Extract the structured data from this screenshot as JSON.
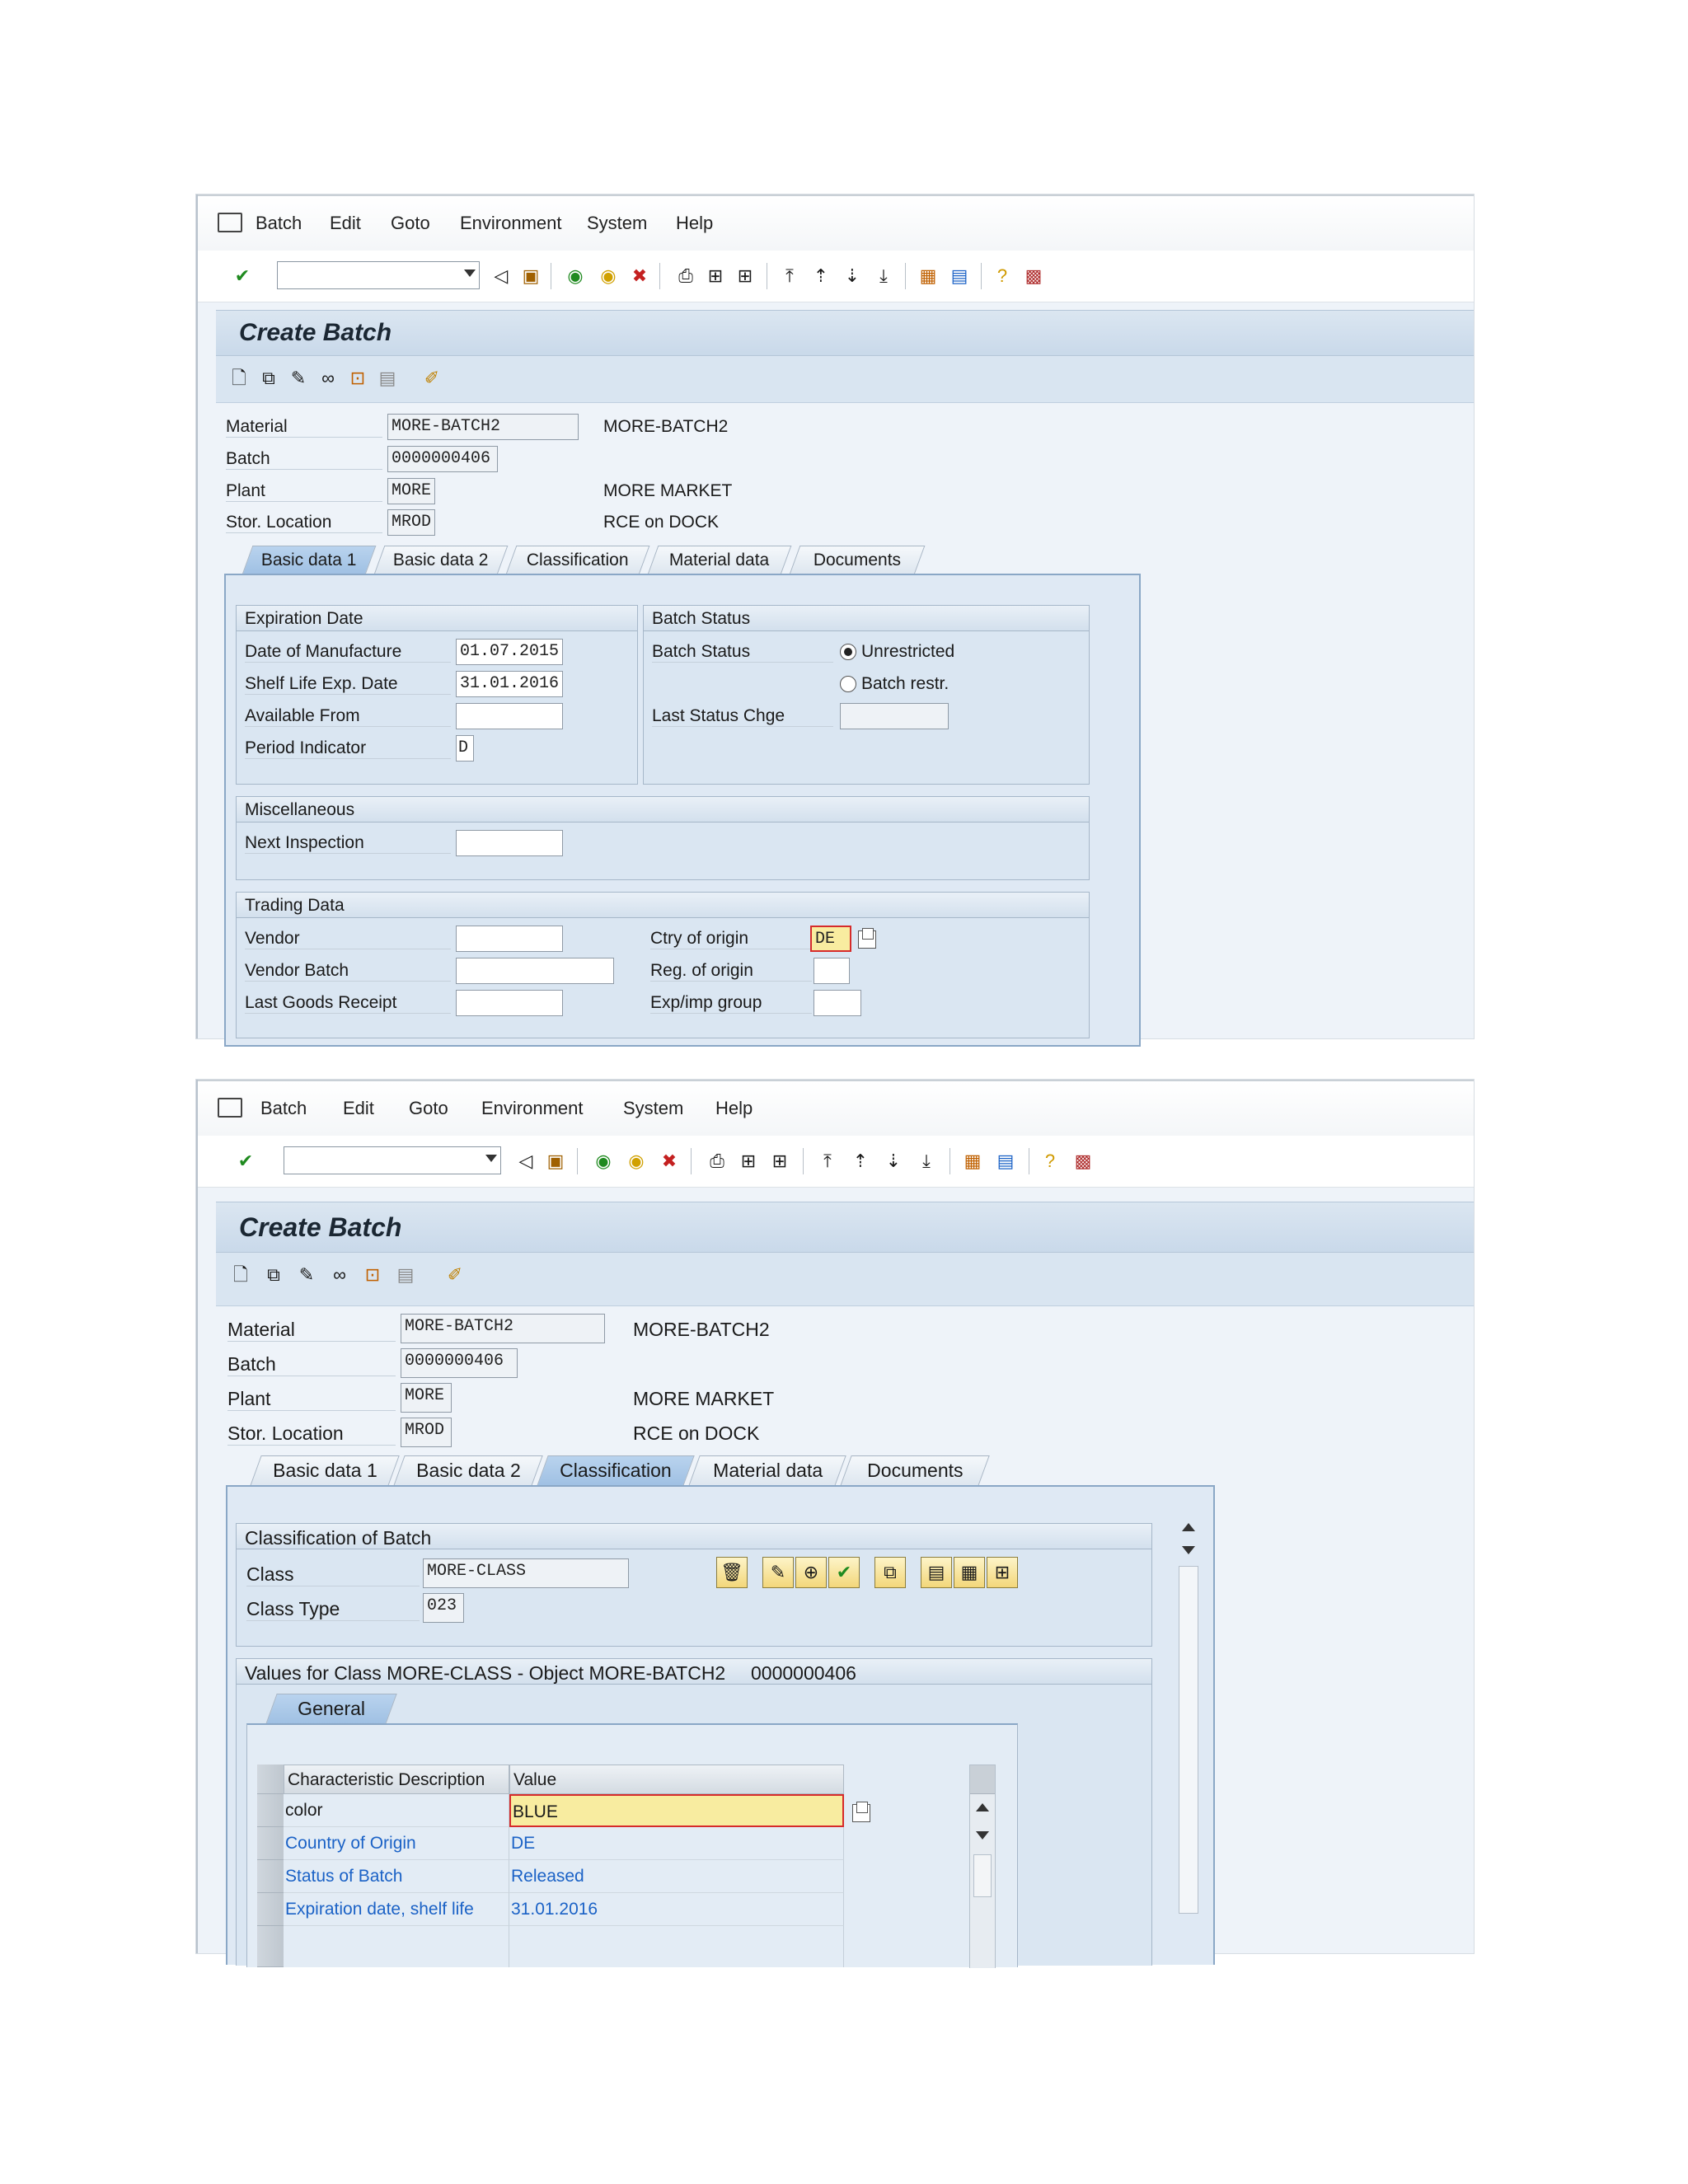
{
  "menu": {
    "batch": "Batch",
    "edit": "Edit",
    "goto": "Goto",
    "environment": "Environment",
    "system": "System",
    "help": "Help"
  },
  "screen1": {
    "title": "Create Batch",
    "header": {
      "material_label": "Material",
      "material_value": "MORE-BATCH2",
      "material_desc": "MORE-BATCH2",
      "batch_label": "Batch",
      "batch_value": "0000000406",
      "plant_label": "Plant",
      "plant_value": "MORE",
      "plant_desc": "MORE MARKET",
      "sloc_label": "Stor. Location",
      "sloc_value": "MROD",
      "sloc_desc": "RCE on DOCK"
    },
    "tabs": [
      "Basic data 1",
      "Basic data 2",
      "Classification",
      "Material data",
      "Documents"
    ],
    "active_tab": "Basic data 1",
    "expiration": {
      "title": "Expiration Date",
      "dom_label": "Date of Manufacture",
      "dom_value": "01.07.2015",
      "sled_label": "Shelf Life Exp. Date",
      "sled_value": "31.01.2016",
      "avail_label": "Available From",
      "avail_value": "",
      "period_label": "Period Indicator",
      "period_value": "D"
    },
    "batch_status": {
      "title": "Batch Status",
      "status_label": "Batch Status",
      "opt_unrestricted": "Unrestricted",
      "opt_restricted": "Batch restr.",
      "selected": "Unrestricted",
      "last_chg_label": "Last Status Chge",
      "last_chg_value": ""
    },
    "misc": {
      "title": "Miscellaneous",
      "next_insp_label": "Next Inspection",
      "next_insp_value": ""
    },
    "trading": {
      "title": "Trading Data",
      "vendor_label": "Vendor",
      "vendor_value": "",
      "vbatch_label": "Vendor Batch",
      "vbatch_value": "",
      "lgr_label": "Last Goods Receipt",
      "lgr_value": "",
      "ctry_label": "Ctry of origin",
      "ctry_value": "DE",
      "reg_label": "Reg. of origin",
      "reg_value": "",
      "exp_label": "Exp/imp group",
      "exp_value": ""
    }
  },
  "screen2": {
    "title": "Create Batch",
    "header": {
      "material_label": "Material",
      "material_value": "MORE-BATCH2",
      "material_desc": "MORE-BATCH2",
      "batch_label": "Batch",
      "batch_value": "0000000406",
      "plant_label": "Plant",
      "plant_value": "MORE",
      "plant_desc": "MORE MARKET",
      "sloc_label": "Stor. Location",
      "sloc_value": "MROD",
      "sloc_desc": "RCE on DOCK"
    },
    "tabs": [
      "Basic data 1",
      "Basic data 2",
      "Classification",
      "Material data",
      "Documents"
    ],
    "active_tab": "Classification",
    "class_group": {
      "title": "Classification of Batch",
      "class_label": "Class",
      "class_value": "MORE-CLASS",
      "type_label": "Class Type",
      "type_value": "023"
    },
    "values_group": {
      "title": "Values for Class MORE-CLASS - Object MORE-BATCH2",
      "object_no": "0000000406",
      "subtab": "General",
      "col_desc": "Characteristic Description",
      "col_value": "Value",
      "rows": [
        {
          "desc": "color",
          "value": "BLUE"
        },
        {
          "desc": "Country of Origin",
          "value": "DE"
        },
        {
          "desc": "Status of Batch",
          "value": "Released"
        },
        {
          "desc": "Expiration date, shelf life",
          "value": "31.01.2016"
        }
      ]
    }
  },
  "colors": {
    "accent_blue": "#1b62c6",
    "highlight_yellow": "#f8eca0",
    "error_red": "#d62b2b",
    "panel_bg": "#dfe9f4"
  }
}
